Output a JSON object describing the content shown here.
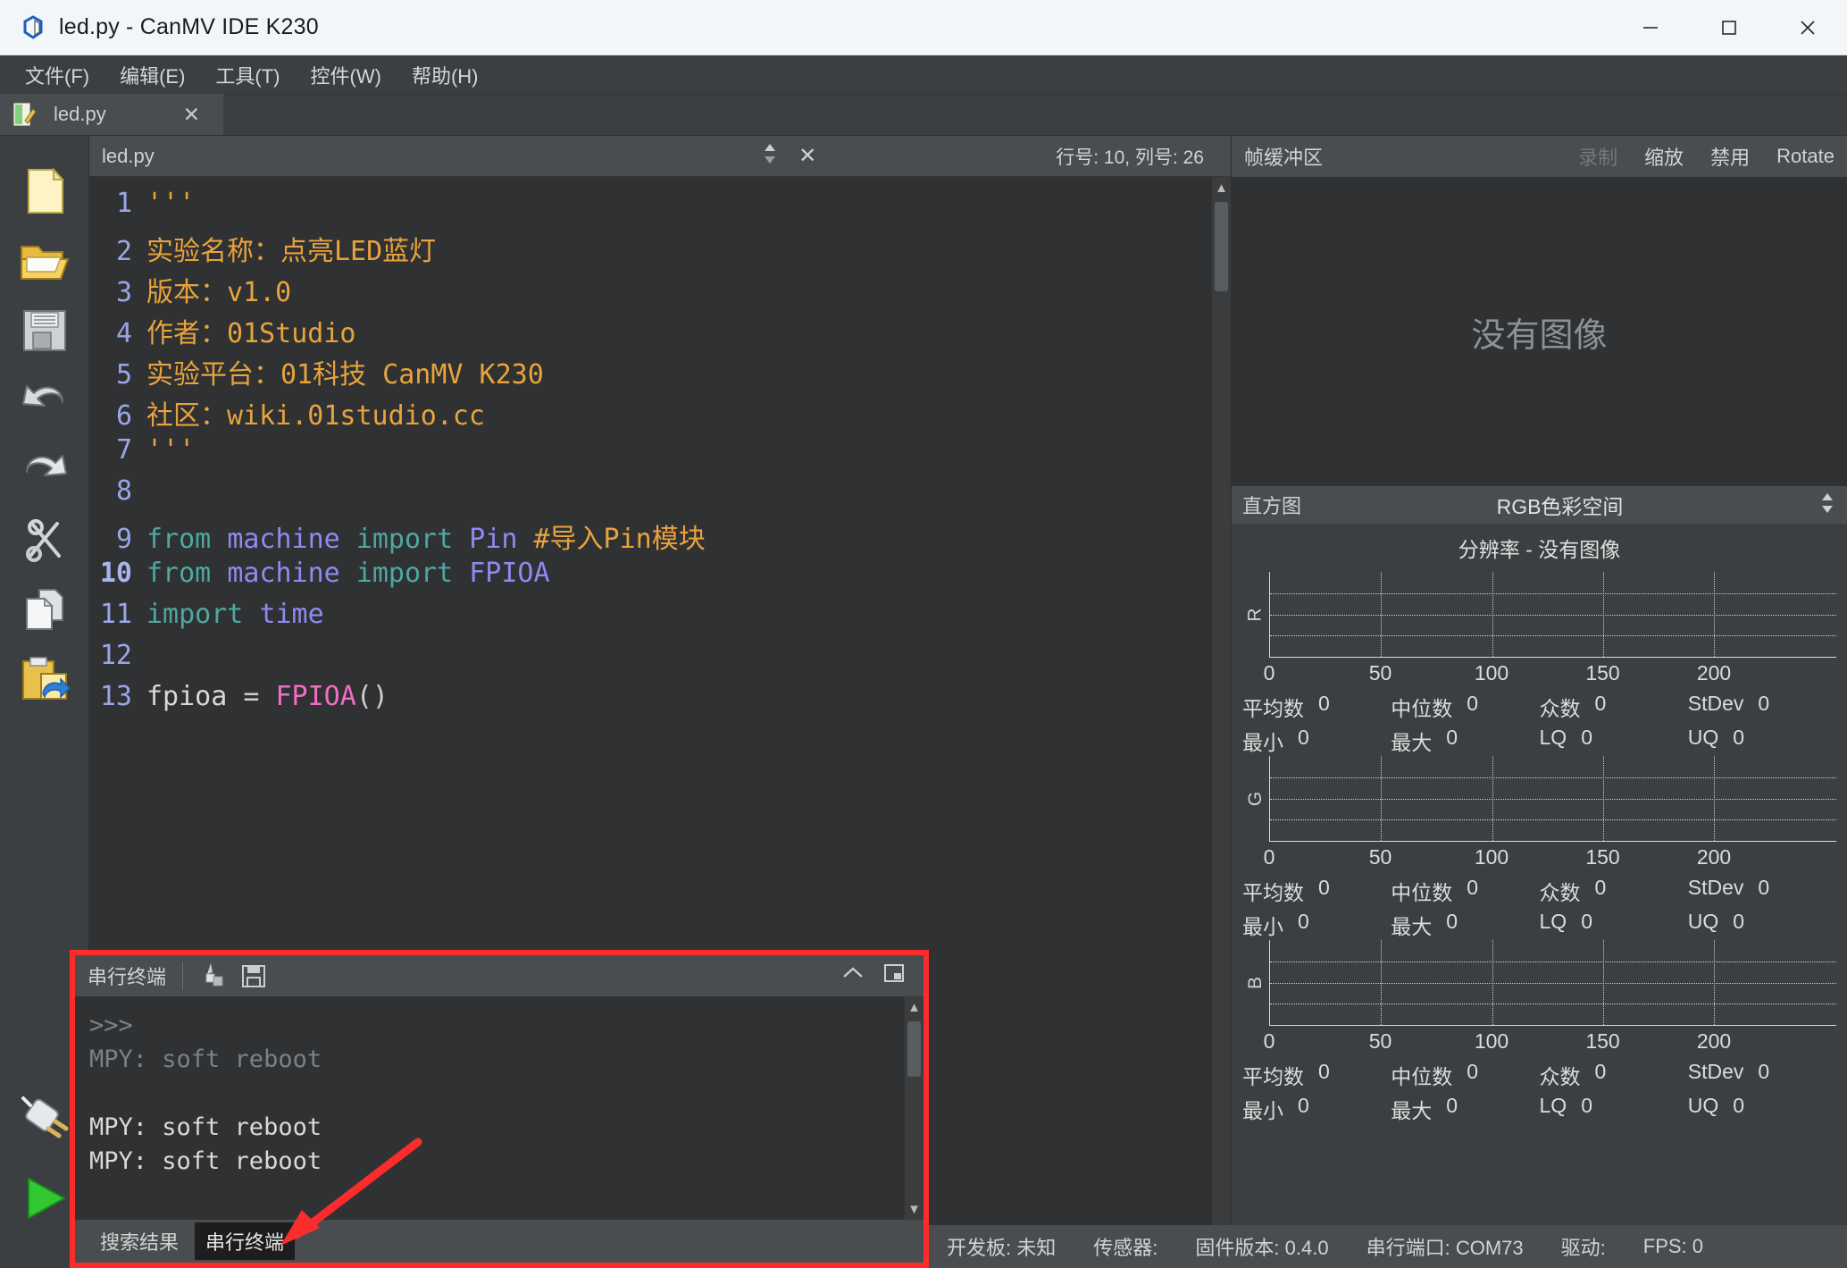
{
  "window": {
    "title": "led.py - CanMV IDE K230",
    "app_icon": "canmv-logo-icon",
    "minimize": "—",
    "maximize": "☐",
    "close": "✕"
  },
  "menubar": [
    {
      "label": "文件(F)",
      "name": "menu-file"
    },
    {
      "label": "编辑(E)",
      "name": "menu-edit"
    },
    {
      "label": "工具(T)",
      "name": "menu-tools"
    },
    {
      "label": "控件(W)",
      "name": "menu-widgets"
    },
    {
      "label": "帮助(H)",
      "name": "menu-help"
    }
  ],
  "doc_tab": {
    "label": "led.py",
    "close": "✕"
  },
  "left_toolbar": [
    {
      "name": "new-file-icon",
      "tip": "新建"
    },
    {
      "name": "open-folder-icon",
      "tip": "打开"
    },
    {
      "name": "save-floppy-icon",
      "tip": "保存"
    },
    {
      "name": "undo-icon",
      "tip": "撤销"
    },
    {
      "name": "redo-icon",
      "tip": "重做"
    },
    {
      "name": "cut-scissors-icon",
      "tip": "剪切"
    },
    {
      "name": "copy-icon",
      "tip": "复制"
    },
    {
      "name": "paste-icon",
      "tip": "粘贴"
    },
    {
      "name": "connect-plug-icon",
      "tip": "连接"
    },
    {
      "name": "run-play-icon",
      "tip": "运行"
    }
  ],
  "editor": {
    "filename": "led.py",
    "position": "行号: 10, 列号: 26",
    "close": "✕",
    "current_line": 10,
    "lines": [
      {
        "n": 1,
        "tokens": [
          {
            "t": "'''",
            "c": "s-str"
          }
        ]
      },
      {
        "n": 2,
        "tokens": [
          {
            "t": "实验名称：点亮LED蓝灯",
            "c": "s-str"
          }
        ]
      },
      {
        "n": 3,
        "tokens": [
          {
            "t": "版本：v1.0",
            "c": "s-str"
          }
        ]
      },
      {
        "n": 4,
        "tokens": [
          {
            "t": "作者：01Studio",
            "c": "s-str"
          }
        ]
      },
      {
        "n": 5,
        "tokens": [
          {
            "t": "实验平台：01科技 CanMV K230",
            "c": "s-str"
          }
        ]
      },
      {
        "n": 6,
        "tokens": [
          {
            "t": "社区：wiki.01studio.cc",
            "c": "s-str"
          }
        ]
      },
      {
        "n": 7,
        "tokens": [
          {
            "t": "'''",
            "c": "s-str"
          }
        ]
      },
      {
        "n": 8,
        "tokens": []
      },
      {
        "n": 9,
        "tokens": [
          {
            "t": "from ",
            "c": "s-kw"
          },
          {
            "t": "machine ",
            "c": "s-id"
          },
          {
            "t": "import ",
            "c": "s-kw"
          },
          {
            "t": "Pin ",
            "c": "s-id"
          },
          {
            "t": "#导入Pin模块",
            "c": "s-com"
          }
        ]
      },
      {
        "n": 10,
        "tokens": [
          {
            "t": "from ",
            "c": "s-kw"
          },
          {
            "t": "machine ",
            "c": "s-id"
          },
          {
            "t": "import ",
            "c": "s-kw"
          },
          {
            "t": "FPIOA",
            "c": "s-id"
          }
        ]
      },
      {
        "n": 11,
        "tokens": [
          {
            "t": "import ",
            "c": "s-kw"
          },
          {
            "t": "time",
            "c": "s-id"
          }
        ]
      },
      {
        "n": 12,
        "tokens": []
      },
      {
        "n": 13,
        "tokens": [
          {
            "t": "fpioa ",
            "c": "ctext"
          },
          {
            "t": "= ",
            "c": "s-pun"
          },
          {
            "t": "FPIOA",
            "c": "s-cls"
          },
          {
            "t": "()",
            "c": "s-pun"
          }
        ]
      }
    ]
  },
  "terminal": {
    "title": "串行终端",
    "clear_icon": "clear-brush-icon",
    "save_icon": "save-floppy-icon",
    "collapse_icon": "⌃",
    "detach_icon": "⧉",
    "lines": [
      {
        "text": ">>>",
        "style": "t-dim"
      },
      {
        "text": "MPY: soft reboot",
        "style": "t-dim"
      },
      {
        "text": "",
        "style": "t-lit"
      },
      {
        "text": "MPY: soft reboot",
        "style": "t-lit"
      },
      {
        "text": "MPY: soft reboot",
        "style": "t-lit"
      }
    ],
    "tabs": [
      {
        "label": "搜索结果",
        "selected": false,
        "name": "tab-search-results"
      },
      {
        "label": "串行终端",
        "selected": true,
        "name": "tab-serial-terminal"
      }
    ]
  },
  "statusbar": {
    "board_label": "开发板:",
    "board_value": "未知",
    "sensor_label": "传感器:",
    "sensor_value": "",
    "firmware_label": "固件版本:",
    "firmware_value": "0.4.0",
    "port_label": "串行端口:",
    "port_value": "COM73",
    "driver_label": "驱动:",
    "driver_value": "",
    "fps_label": "FPS:",
    "fps_value": "0"
  },
  "framebuffer": {
    "title": "帧缓冲区",
    "actions": [
      {
        "label": "录制",
        "disabled": true,
        "name": "fb-record-button"
      },
      {
        "label": "缩放",
        "disabled": false,
        "name": "fb-zoom-button"
      },
      {
        "label": "禁用",
        "disabled": false,
        "name": "fb-disable-button"
      },
      {
        "label": "Rotate",
        "disabled": false,
        "name": "fb-rotate-button"
      }
    ],
    "empty_text": "没有图像"
  },
  "histogram": {
    "title": "直方图",
    "colorspace": "RGB色彩空间",
    "resolution_text": "分辨率 - 没有图像",
    "stat_labels": {
      "mean": "平均数",
      "median": "中位数",
      "mode": "众数",
      "stdev": "StDev",
      "min": "最小",
      "max": "最大",
      "lq": "LQ",
      "uq": "UQ"
    },
    "channels": [
      {
        "label": "R",
        "mean": "0",
        "median": "0",
        "mode": "0",
        "stdev": "0",
        "min": "0",
        "max": "0",
        "lq": "0",
        "uq": "0"
      },
      {
        "label": "G",
        "mean": "0",
        "median": "0",
        "mode": "0",
        "stdev": "0",
        "min": "0",
        "max": "0",
        "lq": "0",
        "uq": "0"
      },
      {
        "label": "B",
        "mean": "0",
        "median": "0",
        "mode": "0",
        "stdev": "0",
        "min": "0",
        "max": "0",
        "lq": "0",
        "uq": "0"
      }
    ]
  },
  "chart_data": {
    "type": "bar",
    "title": "分辨率 - 没有图像",
    "subtitle": "RGB色彩空间",
    "xlabel": "",
    "ylabel": "",
    "xlim": [
      0,
      255
    ],
    "ticks": [
      0,
      50,
      100,
      150,
      200
    ],
    "grid": true,
    "legend": "none",
    "series": [
      {
        "name": "R",
        "categories": [
          0,
          50,
          100,
          150,
          200
        ],
        "values": [
          0,
          0,
          0,
          0,
          0
        ]
      },
      {
        "name": "G",
        "categories": [
          0,
          50,
          100,
          150,
          200
        ],
        "values": [
          0,
          0,
          0,
          0,
          0
        ]
      },
      {
        "name": "B",
        "categories": [
          0,
          50,
          100,
          150,
          200
        ],
        "values": [
          0,
          0,
          0,
          0,
          0
        ]
      }
    ]
  },
  "colors": {
    "highlight_red": "#fb2c2c",
    "panel_bg": "#3c3f41",
    "editor_bg": "#2f3133",
    "header_bg": "#4a4d4f"
  }
}
